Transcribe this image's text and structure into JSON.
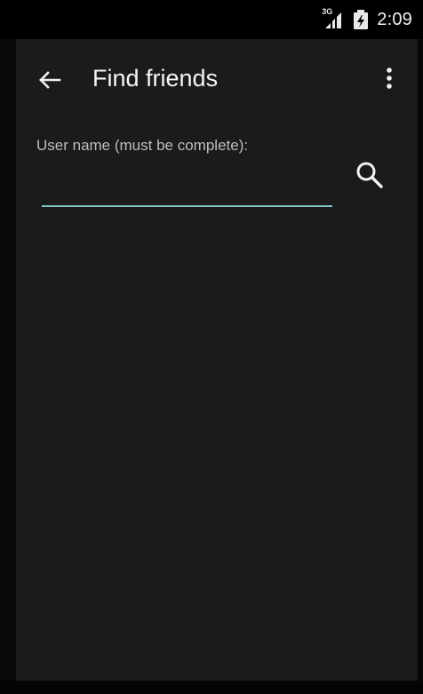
{
  "status_bar": {
    "network_badge": "3G",
    "time": "2:09",
    "icons": [
      "signal-icon",
      "battery-icon"
    ]
  },
  "app_bar": {
    "title": "Find friends",
    "back_icon": "arrow-back-icon",
    "menu_icon": "overflow-menu-icon"
  },
  "form": {
    "label": "User name (must be complete):",
    "input_value": "",
    "input_placeholder": "",
    "search_icon": "search-icon"
  },
  "colors": {
    "background": "#1b1b1b",
    "status_bar": "#000000",
    "accent_underline": "#7fc6c9",
    "text_primary": "#f4f4f4",
    "text_secondary": "#bdbdbd"
  }
}
